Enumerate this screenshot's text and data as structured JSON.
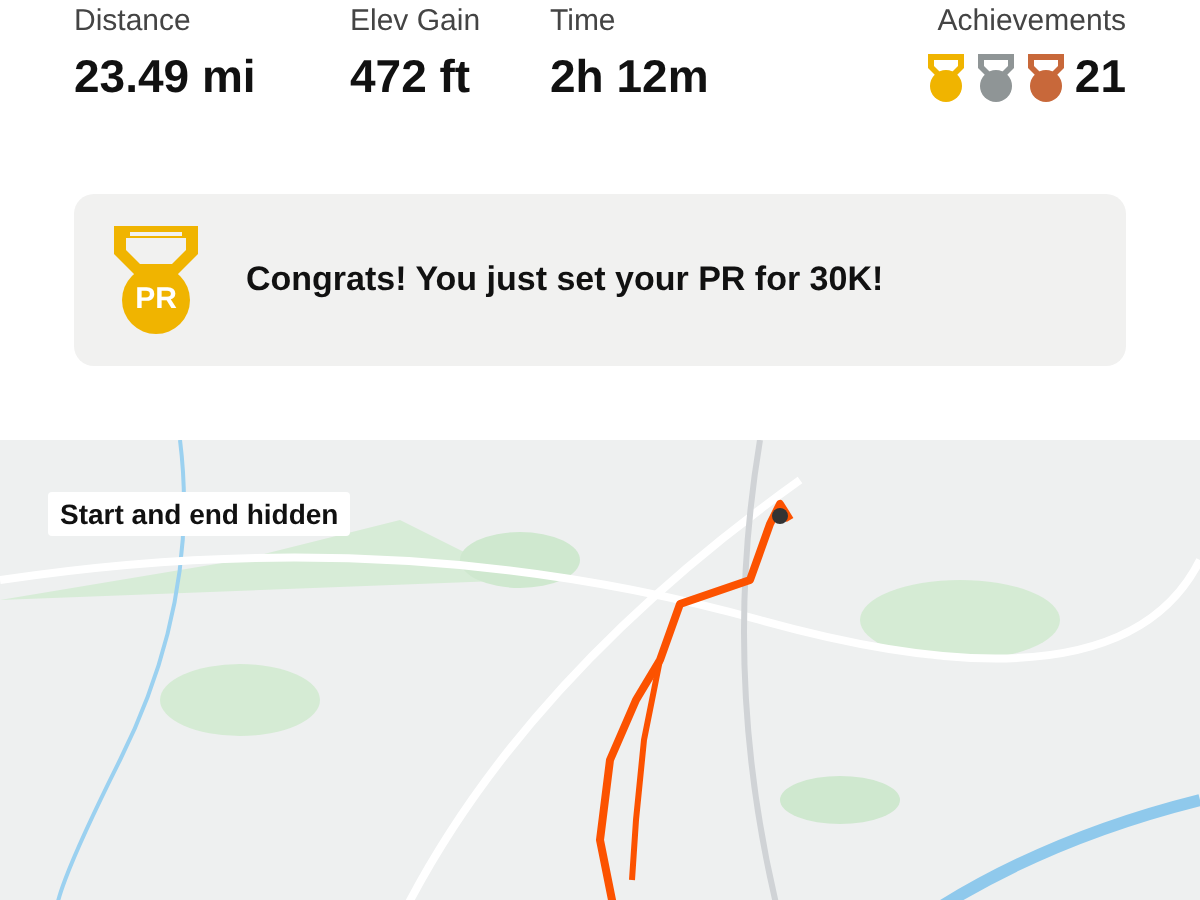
{
  "stats": [
    {
      "label": "Distance",
      "value": "23.49 mi"
    },
    {
      "label": "Elev Gain",
      "value": "472 ft"
    },
    {
      "label": "Time",
      "value": "2h 12m"
    }
  ],
  "achievements": {
    "label": "Achievements",
    "medals": [
      {
        "color": "#f0b400"
      },
      {
        "color": "#8f9596"
      },
      {
        "color": "#c8683a"
      }
    ],
    "count": "21"
  },
  "banner": {
    "badge": "PR",
    "message": "Congrats! You just set your PR for 30K!"
  },
  "map": {
    "kind": "picture",
    "note": "Start and end hidden"
  }
}
